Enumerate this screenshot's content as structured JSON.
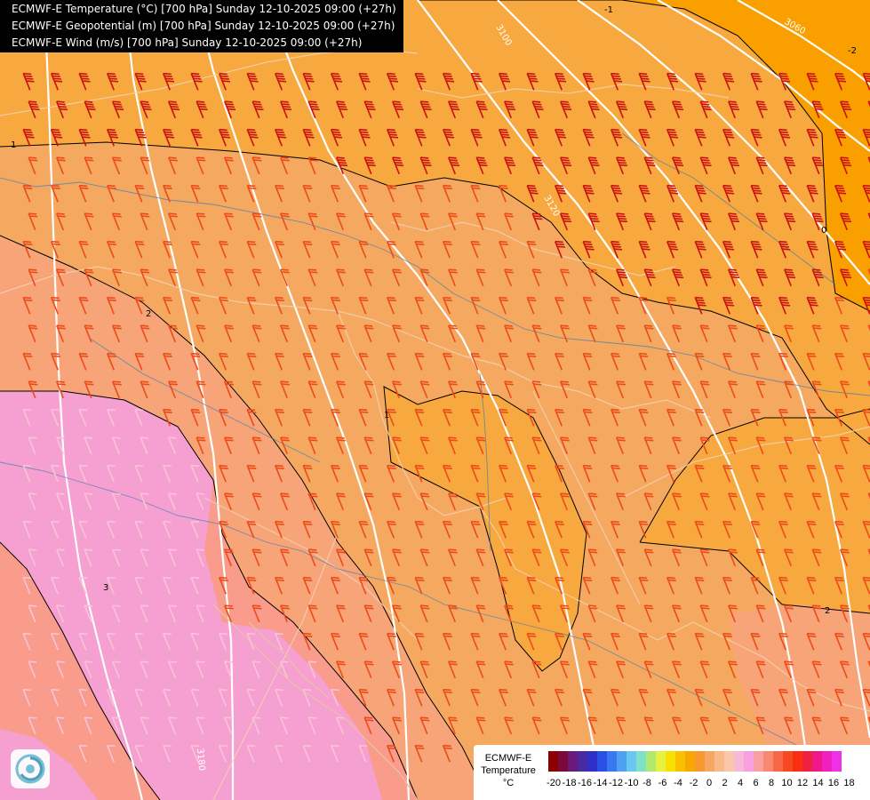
{
  "titles": {
    "line1": "ECMWF-E Temperature (°C) [700 hPa] Sunday 12-10-2025 09:00 (+27h)",
    "line2": "ECMWF-E Geopotential (m) [700 hPa] Sunday 12-10-2025 09:00 (+27h)",
    "line3": "ECMWF-E Wind (m/s) [700 hPa] Sunday 12-10-2025 09:00 (+27h)"
  },
  "legend": {
    "title_line1": "ECMWF-E",
    "title_line2": "Temperature",
    "unit": "°C",
    "tick_labels": [
      "-20",
      "-18",
      "-16",
      "-14",
      "-12",
      "-10",
      "-8",
      "-6",
      "-4",
      "-2",
      "0",
      "2",
      "4",
      "6",
      "8",
      "10",
      "12",
      "14",
      "16",
      "18"
    ],
    "colors": [
      "#8b0000",
      "#7a0a3a",
      "#6a1a7a",
      "#4a2aa0",
      "#3030c8",
      "#2a50e6",
      "#3a78f0",
      "#50a0f0",
      "#6ac8f0",
      "#80e0c8",
      "#b0e870",
      "#e8f040",
      "#f8e000",
      "#f8c000",
      "#f8a800",
      "#f89830",
      "#f7a664",
      "#f8b888",
      "#fac8a8",
      "#f8b8d8",
      "#f8a0e0",
      "#f8a0a0",
      "#f88870",
      "#f86848",
      "#f84820",
      "#f83010",
      "#f02040",
      "#f01888",
      "#f020c0",
      "#f030e8"
    ]
  },
  "isolines": {
    "geopotential_labels": [
      "3100",
      "3060",
      "3120",
      "3180"
    ],
    "temperature_labels": [
      "1",
      "1",
      "2",
      "2",
      "3",
      "-1",
      "0",
      "-2"
    ]
  },
  "map_colors": {
    "zone_1_to_2": "#f5a960",
    "zone_0_to_1": "#f7a83e",
    "zone_minus1_to_0": "#f9a000",
    "zone_2_to_3": "#f7a478",
    "zone_3_to_4": "#f99c8c",
    "zone_over_4": "#f5a0d0",
    "barb_strong": "#cc1010",
    "barb_medium": "#ee4a18",
    "barb_weak": "#f9c4d6",
    "isoline_geopotential": "#ffffff",
    "isoline_temperature": "#000000"
  },
  "icons": {
    "logo": "ecmwf-logo-icon"
  }
}
